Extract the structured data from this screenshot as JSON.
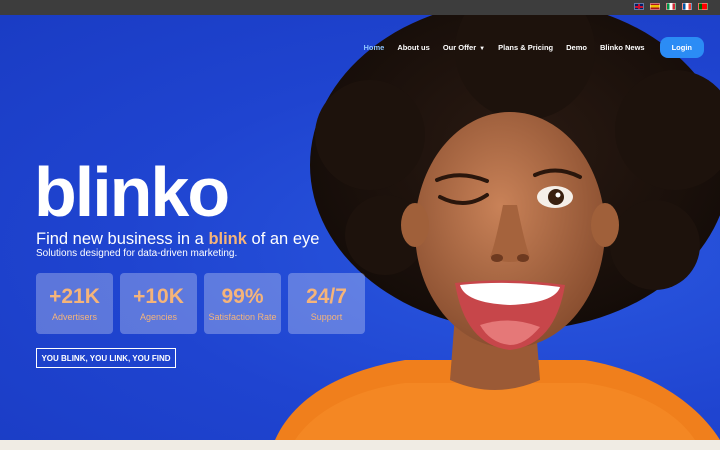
{
  "topbar": {
    "languages": [
      "English",
      "Español",
      "Italiano",
      "Français",
      "Português"
    ]
  },
  "nav": {
    "items": [
      {
        "label": "Home",
        "active": true
      },
      {
        "label": "About us"
      },
      {
        "label": "Our Offer",
        "has_dropdown": true
      },
      {
        "label": "Plans & Pricing"
      },
      {
        "label": "Demo"
      },
      {
        "label": "Blinko News"
      }
    ],
    "login_label": "Login"
  },
  "hero": {
    "logo": "blinko",
    "headline_before": "Find new business in a ",
    "headline_highlight": "blink",
    "headline_after": " of an eye",
    "subline": "Solutions designed for data-driven marketing.",
    "stats": [
      {
        "value": "+21K",
        "label": "Advertisers"
      },
      {
        "value": "+10K",
        "label": "Agencies"
      },
      {
        "value": "99%",
        "label": "Satisfaction Rate"
      },
      {
        "value": "24/7",
        "label": "Support"
      }
    ],
    "cta_label": "YOU BLINK, YOU LINK, YOU FIND"
  },
  "colors": {
    "brand_blue": "#1f44d0",
    "accent_orange": "#f5b47a",
    "login_blue": "#2b8cf5"
  }
}
